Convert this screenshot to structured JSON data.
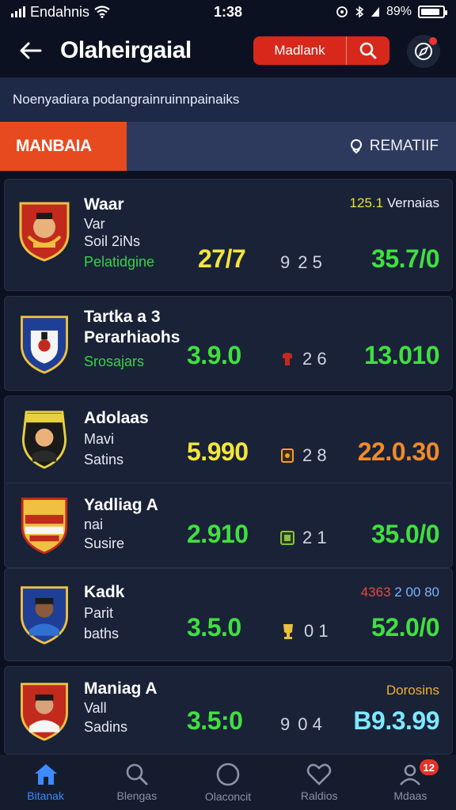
{
  "status": {
    "carrier": "Endahnis",
    "time": "1:38",
    "battery_text": "89%",
    "battery_level": 0.89
  },
  "header": {
    "title": "Olaheirgaial",
    "search_label": "Madlank"
  },
  "subtitle": "Noenyadiara podangrainruinnpainaiks",
  "tabs": {
    "active_label": "MANBAIA",
    "remain_label": "REMATIIF"
  },
  "cards": [
    {
      "name": "Waar",
      "line2": "Var",
      "line3": "Soil 2iNs",
      "line4": "Pelatidgine",
      "meta": "125.1 Vernaias",
      "score1": "27/7",
      "mid_num": "2 5",
      "mid_icon": "9",
      "score2": "35.7/0"
    },
    {
      "name": "Tartka a 3",
      "line2": "Perarhiaohs",
      "line3": "Srosajars",
      "score1": "3.9.0",
      "mid_num": "2 6",
      "score2": "13.010"
    },
    {
      "name": "Adolaas",
      "line2": "Mavi",
      "line3": "Satins",
      "score1": "5.990",
      "mid_num": "2 8",
      "score2": "22.0.30"
    },
    {
      "name": "Yadliag A",
      "line2": "nai",
      "line3": "Susire",
      "score1": "2.910",
      "mid_num": "2 1",
      "score2": "35.0/0"
    },
    {
      "name": "Kadk",
      "line2": "Parit",
      "line3": "baths",
      "meta": "4363 2 00 80",
      "score1": "3.5.0",
      "mid_num": "0 1",
      "score2": "52.0/0"
    },
    {
      "name": "Maniag A",
      "line2": "Vall",
      "line3": "Sadins",
      "meta": "Dorosins",
      "score1": "3.5:0",
      "mid_num": "0 4",
      "mid_icon": "9",
      "score2": "B9.3.99"
    }
  ],
  "nav": {
    "items": [
      {
        "label": "Bitanak",
        "icon": "home-icon"
      },
      {
        "label": "Blengas",
        "icon": "search-icon"
      },
      {
        "label": "Olaconcit",
        "icon": "circle-icon"
      },
      {
        "label": "Raldios",
        "icon": "heart-icon"
      },
      {
        "label": "Mdaas",
        "icon": "profile-icon"
      }
    ],
    "badge_count": "12"
  },
  "colors": {
    "accent_red": "#e84a1f",
    "score_green": "#3fe03f",
    "score_yellow": "#f3e63a",
    "score_orange": "#f08a28",
    "nav_active": "#3d8bff"
  }
}
